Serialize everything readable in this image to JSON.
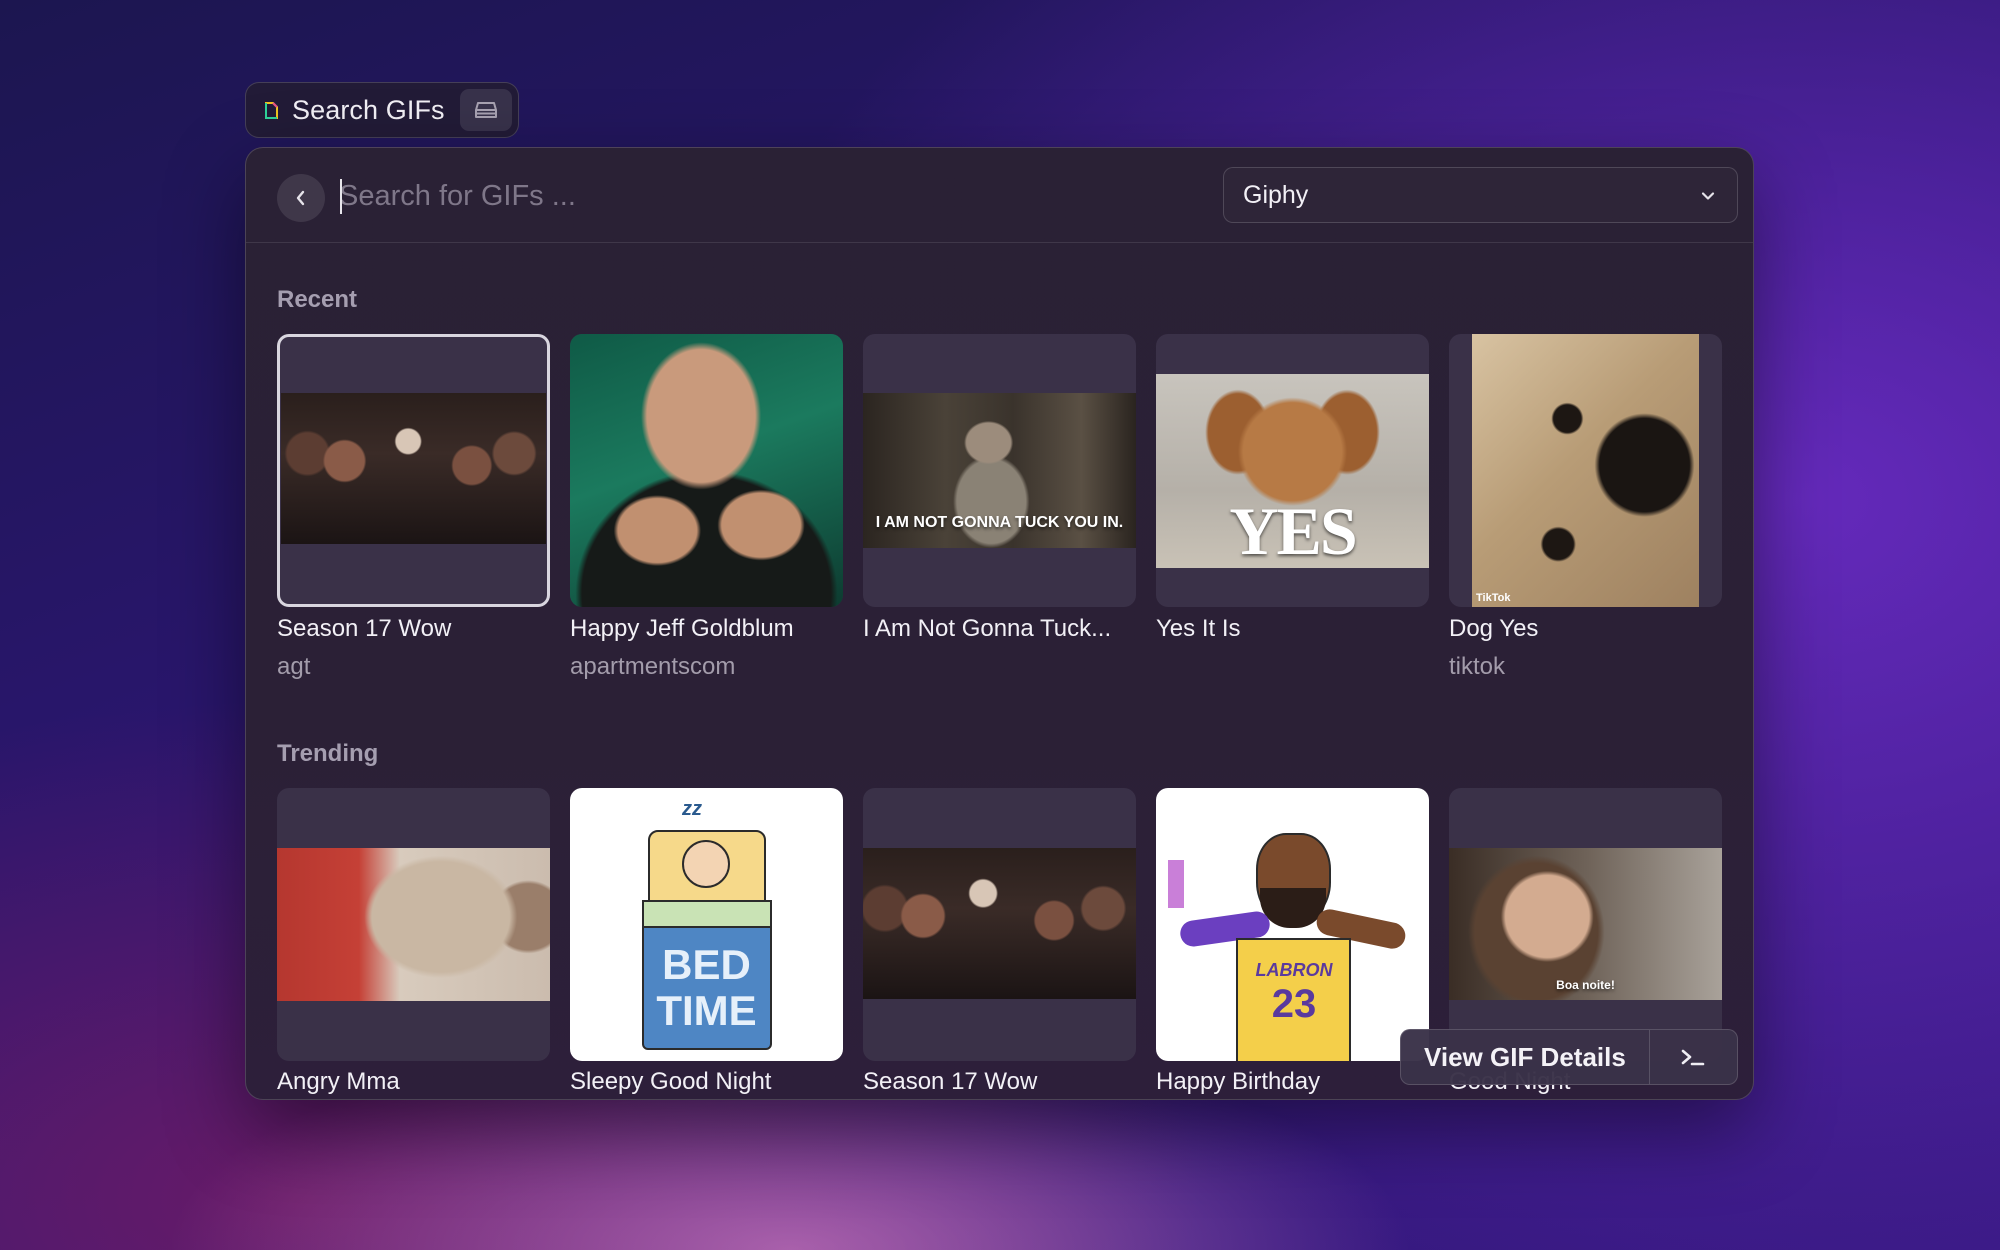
{
  "header": {
    "title": "Search GIFs",
    "extension_icon": "raycast-gif-icon",
    "action_icon": "tray-icon"
  },
  "search": {
    "placeholder": "Search for GIFs ...",
    "value": "",
    "back_icon": "chevron-left-icon"
  },
  "provider": {
    "selected": "Giphy",
    "icon": "chevron-down-icon"
  },
  "sections": {
    "recent": {
      "label": "Recent",
      "items": [
        {
          "title": "Season 17 Wow",
          "subtitle": "agt",
          "selected": true
        },
        {
          "title": "Happy Jeff Goldblum",
          "subtitle": "apartmentscom"
        },
        {
          "title": "I Am Not Gonna Tuck...",
          "subtitle": "",
          "caption": "I AM NOT GONNA TUCK YOU IN."
        },
        {
          "title": "Yes It Is",
          "subtitle": "",
          "caption": "YES"
        },
        {
          "title": "Dog Yes",
          "subtitle": "tiktok",
          "caption": "TikTok"
        }
      ]
    },
    "trending": {
      "label": "Trending",
      "items": [
        {
          "title": "Angry Mma"
        },
        {
          "title": "Sleepy Good Night",
          "caption_line1": "BED",
          "caption_line2": "TIME",
          "caption_top": "zz"
        },
        {
          "title": "Season 17 Wow"
        },
        {
          "title": "Happy Birthday",
          "caption": "23",
          "caption_jersey": "LABRON"
        },
        {
          "title": "Good Night",
          "caption": "Boa noite!"
        }
      ]
    }
  },
  "actions": {
    "primary": "View GIF Details",
    "secondary_icon": "terminal-icon"
  }
}
